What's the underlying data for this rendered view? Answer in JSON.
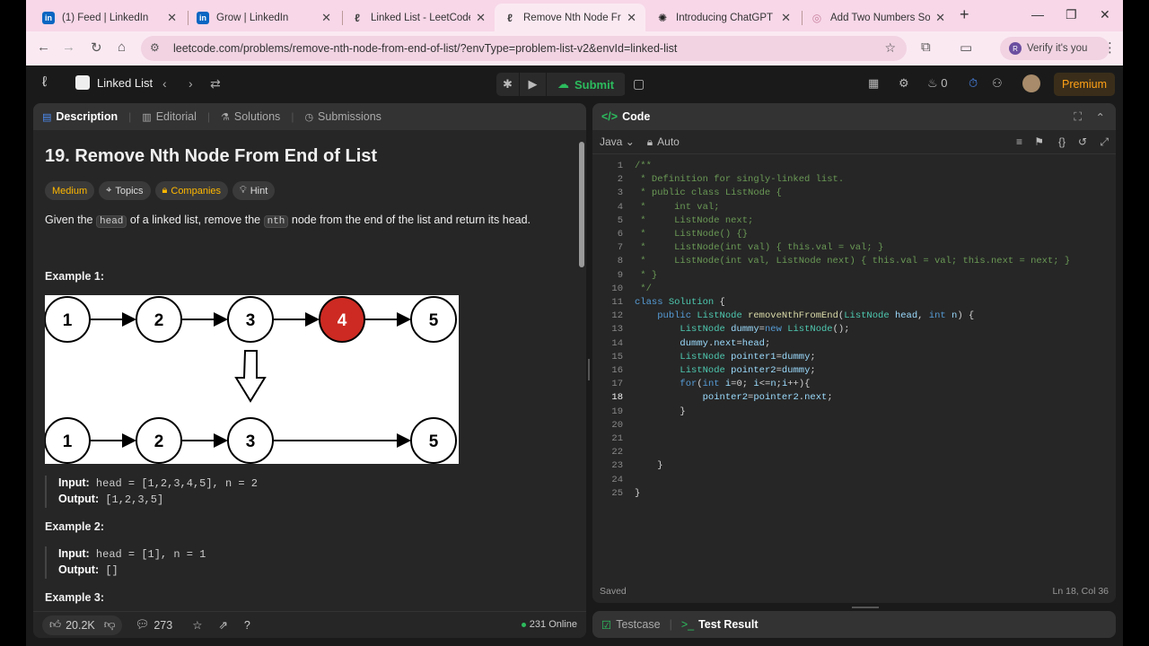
{
  "browser": {
    "tabs": [
      {
        "title": "(1) Feed | LinkedIn",
        "icon": "linkedin-icon",
        "color": "#0a66c2"
      },
      {
        "title": "Grow | LinkedIn",
        "icon": "linkedin-icon",
        "color": "#0a66c2"
      },
      {
        "title": "Linked List - LeetCode",
        "icon": "leetcode-icon",
        "color": "#444444"
      },
      {
        "title": "Remove Nth Node From",
        "icon": "leetcode-icon",
        "color": "#444444"
      },
      {
        "title": "Introducing ChatGPT | C",
        "icon": "openai-icon",
        "color": "#222222"
      },
      {
        "title": "Add Two Numbers Solut",
        "icon": "globe-icon",
        "color": "#d9a0c0"
      }
    ],
    "url": "leetcode.com/problems/remove-nth-node-from-end-of-list/?envType=problem-list-v2&envId=linked-list",
    "profile_label": "Verify it's you",
    "profile_initial": "R"
  },
  "nav": {
    "list_label": "Linked List",
    "submit_label": "Submit",
    "streak_count": "0",
    "premium_label": "Premium"
  },
  "left": {
    "tabs": [
      "Description",
      "Editorial",
      "Solutions",
      "Submissions"
    ],
    "problem_title": "19. Remove Nth Node From End of List",
    "tags": [
      "Medium",
      "Topics",
      "Companies",
      "Hint"
    ],
    "desc_part1": "Given the",
    "desc_code1": "head",
    "desc_part2": "of a linked list, remove the",
    "desc_code2": "nth",
    "desc_part3": "node from the end of the list and return its head.",
    "example1_label": "Example 1:",
    "example2_label": "Example 2:",
    "example3_label": "Example 3:",
    "input_label": "Input:",
    "output_label": "Output:",
    "ex1_input": "head = [1,2,3,4,5], n = 2",
    "ex1_output": "[1,2,3,5]",
    "ex2_input": "head = [1], n = 1",
    "ex2_output": "[]",
    "likes": "20.2K",
    "comments": "273",
    "online": "231 Online",
    "diagram_top": [
      "1",
      "2",
      "3",
      "4",
      "5"
    ],
    "diagram_bottom": [
      "1",
      "2",
      "3",
      "5"
    ]
  },
  "right": {
    "title": "Code",
    "language": "Java",
    "mode": "Auto",
    "saved": "Saved",
    "cursor": "Ln 18, Col 36",
    "bottom_tabs": [
      "Testcase",
      "Test Result"
    ],
    "code_lines": [
      "/**",
      " * Definition for singly-linked list.",
      " * public class ListNode {",
      " *     int val;",
      " *     ListNode next;",
      " *     ListNode() {}",
      " *     ListNode(int val) { this.val = val; }",
      " *     ListNode(int val, ListNode next) { this.val = val; this.next = next; }",
      " * }",
      " */",
      "class Solution {",
      "    public ListNode removeNthFromEnd(ListNode head, int n) {",
      "        ListNode dummy=new ListNode();",
      "        dummy.next=head;",
      "        ListNode pointer1=dummy;",
      "        ListNode pointer2=dummy;",
      "        for(int i=0; i<=n;i++){",
      "            pointer2=pointer2.next;",
      "        }",
      "",
      "",
      "",
      "    }",
      "",
      "}"
    ]
  }
}
